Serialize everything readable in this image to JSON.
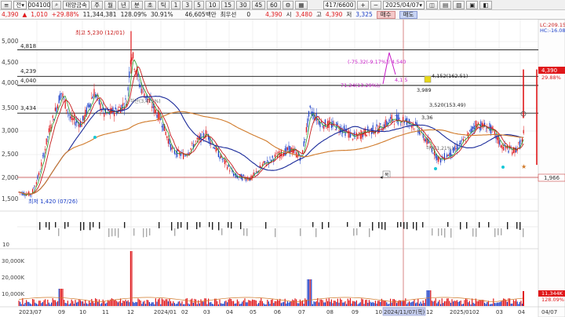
{
  "toolbar": {
    "menu_label": "≡",
    "market_select": "전",
    "stock_code": "004100",
    "stock_name": "태양금속",
    "period_buttons": [
      "주",
      "월",
      "년",
      "분",
      "초",
      "틱"
    ],
    "minute_buttons": [
      "1",
      "3",
      "5",
      "10",
      "15",
      "30",
      "45",
      "60"
    ],
    "count": "417",
    "total_count": "6600",
    "date": "2025/04/07"
  },
  "quote": {
    "price": "4,390",
    "change": "1,010",
    "change_pct": "+29.88%",
    "volume": "11,344,381",
    "vol_ratio": "128.09%",
    "turnover": "30.91%",
    "amount": "46,605백만",
    "pref_label": "최우선",
    "pref_value": "0",
    "last_price": "4,390",
    "open_label": "시",
    "open": "3,480",
    "high_label": "고",
    "high": "4,390",
    "low_label": "저",
    "low": "3,325",
    "buy_label": "매수",
    "sell_label": "매도"
  },
  "price_axis": {
    "ticks": [
      "5,000",
      "4,500",
      "4,000",
      "3,500",
      "3,000",
      "2,500",
      "2,000",
      "1,500"
    ],
    "current_tag": "4,390",
    "current_pct": "29.88%",
    "low_tag": "1,966",
    "ma_label_1": "LC:209.15",
    "ma_label_2": "HC:-16.08"
  },
  "h_levels": [
    {
      "label": "4,818",
      "value": 4818
    },
    {
      "label": "4,239",
      "value": 4239
    },
    {
      "label": "4,040",
      "value": 4040
    },
    {
      "label": "3,434",
      "value": 3434
    }
  ],
  "annotations": {
    "high_label": "최고 5,230 (12/01)",
    "low_label": "최저 1,420 (07/26)",
    "box1_label": "(-75.32(-9.17%)/ 4,540",
    "box2_label": "71.24(13.29%)/",
    "box2_suffix": "4,1 5",
    "label_3989": "3,989",
    "label_4152": "4,152(162.51)",
    "label_3520": "3,520(153.49)",
    "label_3360": "3,36",
    "small_label_1": "하단(3,415%)",
    "small_label_2": "하단(1,21%)",
    "marker": "목"
  },
  "volume_axis": {
    "ticks": [
      "30,000K",
      "20,000K",
      "10,000K"
    ],
    "current_tag": "11,344K",
    "current_pct": "128.09%"
  },
  "osc_axis": {
    "ticks": [
      "10"
    ]
  },
  "x_axis": {
    "labels": [
      "2023/07",
      "09",
      "10",
      "11",
      "12",
      "2024/01",
      "02",
      "03",
      "04",
      "05",
      "06",
      "07",
      "08",
      "09",
      "10",
      "2024/11/07(목)",
      "12",
      "2025/01",
      "02",
      "03",
      "04",
      "04/07"
    ]
  },
  "colors": {
    "candle_up": "#e0171a",
    "candle_down": "#1a3ec8",
    "ma5": "#c81a1a",
    "ma20": "#1a2a9a",
    "ma60": "#d07a2a",
    "ma_short": "#2a9a2a",
    "accent_magenta": "#c81ac8"
  }
}
